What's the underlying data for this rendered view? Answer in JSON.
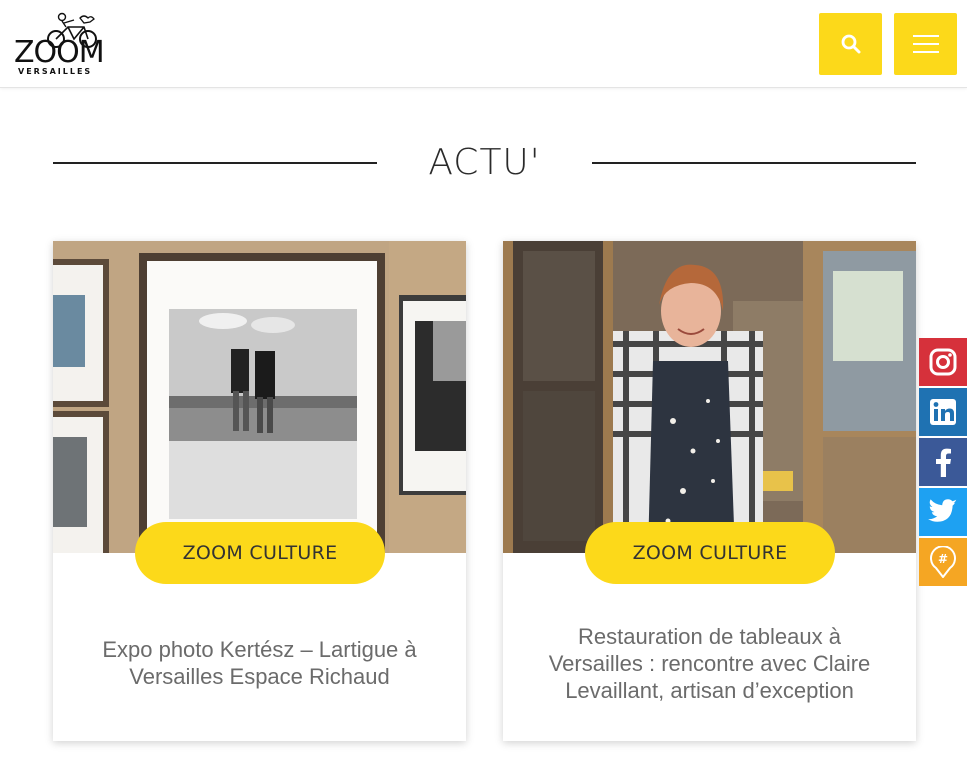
{
  "header": {
    "logo_text": "ZOOM",
    "logo_subtext": "VERSAILLES",
    "search_icon": "search-icon",
    "menu_icon": "hamburger-menu-icon",
    "button_color": "#fcd91a"
  },
  "section": {
    "title": "ACTU'"
  },
  "cards": [
    {
      "badge": "ZOOM CULTURE",
      "title": "Expo photo Kertész – Lartigue à Versailles Espace Richaud",
      "image": "framed-photographs-exhibition-wall"
    },
    {
      "badge": "ZOOM CULTURE",
      "title": "Restauration de tableaux à Versailles : rencontre avec Claire Levaillant, artisan d’exception",
      "image": "woman-in-apron-at-workshop-door"
    }
  ],
  "social": [
    {
      "name": "instagram",
      "icon": "instagram-icon",
      "color": "#d6313b"
    },
    {
      "name": "linkedin",
      "icon": "linkedin-icon",
      "color": "#1f72b2"
    },
    {
      "name": "facebook",
      "icon": "facebook-icon",
      "color": "#3b5998"
    },
    {
      "name": "twitter",
      "icon": "twitter-icon",
      "color": "#1ea1f2"
    },
    {
      "name": "hashtag",
      "icon": "hashtag-pin-icon",
      "color": "#f5a623"
    }
  ]
}
